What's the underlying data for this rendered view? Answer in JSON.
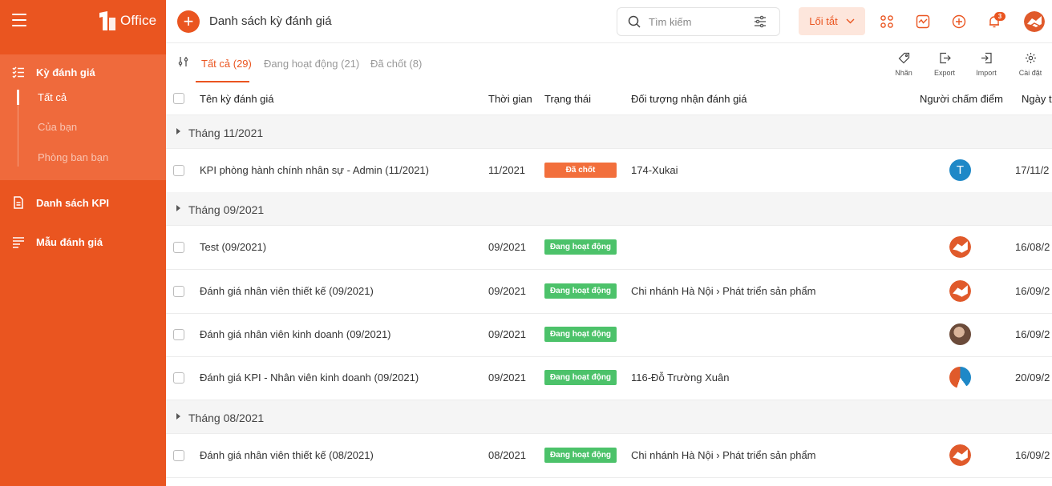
{
  "app": {
    "logo_text": "Office",
    "logo_mark": "1"
  },
  "sidebar": {
    "items": [
      {
        "label": "Kỳ đánh giá",
        "icon": "checklist-icon"
      },
      {
        "label": "Danh sách KPI",
        "icon": "document-icon"
      },
      {
        "label": "Mẫu đánh giá",
        "icon": "list-icon"
      }
    ],
    "subitems": [
      {
        "label": "Tất cả"
      },
      {
        "label": "Của bạn"
      },
      {
        "label": "Phòng ban bạn"
      }
    ]
  },
  "topbar": {
    "title": "Danh sách kỳ đánh giá",
    "add_label": "+",
    "search_placeholder": "Tìm kiếm",
    "shortcut_label": "Lối tắt",
    "notification_count": "3"
  },
  "tabs": [
    {
      "label": "Tất cả (29)"
    },
    {
      "label": "Đang hoạt động (21)"
    },
    {
      "label": "Đã chốt (8)"
    }
  ],
  "actions": [
    {
      "label": "Nhãn",
      "icon": "tag-icon"
    },
    {
      "label": "Export",
      "icon": "export-icon"
    },
    {
      "label": "Import",
      "icon": "import-icon"
    },
    {
      "label": "Cài đặt",
      "icon": "gear-icon"
    }
  ],
  "table": {
    "columns": [
      "Tên kỳ đánh giá",
      "Thời gian",
      "Trạng thái",
      "Đối tượng nhận đánh giá",
      "Người chấm điểm",
      "Ngày tạ"
    ],
    "groups": [
      {
        "label": "Tháng 11/2021"
      },
      {
        "label": "Tháng 09/2021"
      },
      {
        "label": "Tháng 08/2021"
      }
    ],
    "rows": [
      {
        "name": "KPI phòng hành chính nhân sự - Admin (11/2021)",
        "period": "11/2021",
        "status": "Đã chốt",
        "target": "174-Xukai",
        "grader": "T",
        "date": "17/11/2"
      },
      {
        "name": "Test (09/2021)",
        "period": "09/2021",
        "status": "Đang hoạt động",
        "target": "",
        "grader": "",
        "date": "16/08/2"
      },
      {
        "name": "Đánh giá nhân viên thiết kế (09/2021)",
        "period": "09/2021",
        "status": "Đang hoạt động",
        "target": "Chi nhánh Hà Nội › Phát triển sản phẩm",
        "grader": "",
        "date": "16/09/2"
      },
      {
        "name": "Đánh giá nhân viên kinh doanh (09/2021)",
        "period": "09/2021",
        "status": "Đang hoạt động",
        "target": "",
        "grader": "",
        "date": "16/09/2"
      },
      {
        "name": "Đánh giá KPI - Nhân viên kinh doanh (09/2021)",
        "period": "09/2021",
        "status": "Đang hoạt động",
        "target": "116-Đỗ Trường Xuân",
        "grader": "",
        "date": "20/09/2"
      },
      {
        "name": "Đánh giá nhân viên thiết kế (08/2021)",
        "period": "08/2021",
        "status": "Đang hoạt động",
        "target": "Chi nhánh Hà Nội › Phát triển sản phẩm",
        "grader": "",
        "date": "16/09/2"
      }
    ]
  },
  "colors": {
    "brand": "#ea5520",
    "sidebar_active": "#ef6a3c",
    "status_closed": "#f26f3c",
    "status_active": "#4cc26a"
  }
}
